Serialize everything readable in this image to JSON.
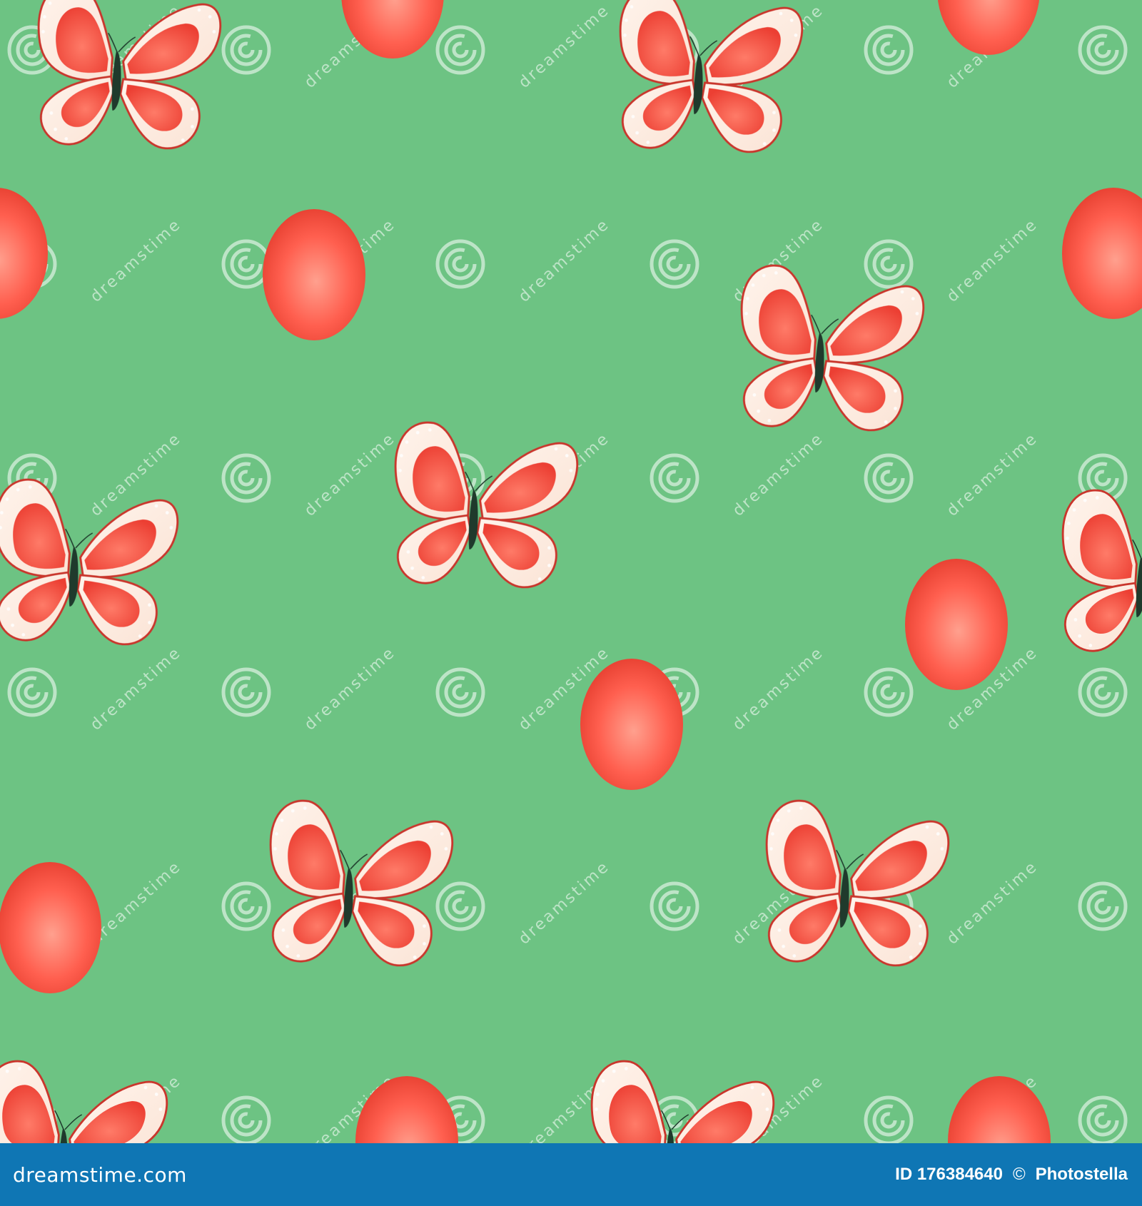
{
  "pattern": {
    "background_color": "#6dc383",
    "egg_color": "#ff5f4f",
    "egg_highlight": "#ffa08e",
    "egg_shade": "#e23a2b",
    "wing_outer_color": "#fbe4d6",
    "wing_inner_color": "#ec3f33",
    "wing_outline_color": "#c9362c",
    "body_color": "#1f3a2c",
    "motifs": [
      "butterfly",
      "egg"
    ],
    "watermark": {
      "text": "dreamstime",
      "icon": "spiral-logo-icon",
      "color": "#ffffff"
    }
  },
  "footer": {
    "background_color": "#0f76b4",
    "text_color": "#ffffff",
    "brand": "dreamstime.com",
    "id_label": "ID 176384640",
    "copyright_icon": "©",
    "author": "Photostella"
  }
}
